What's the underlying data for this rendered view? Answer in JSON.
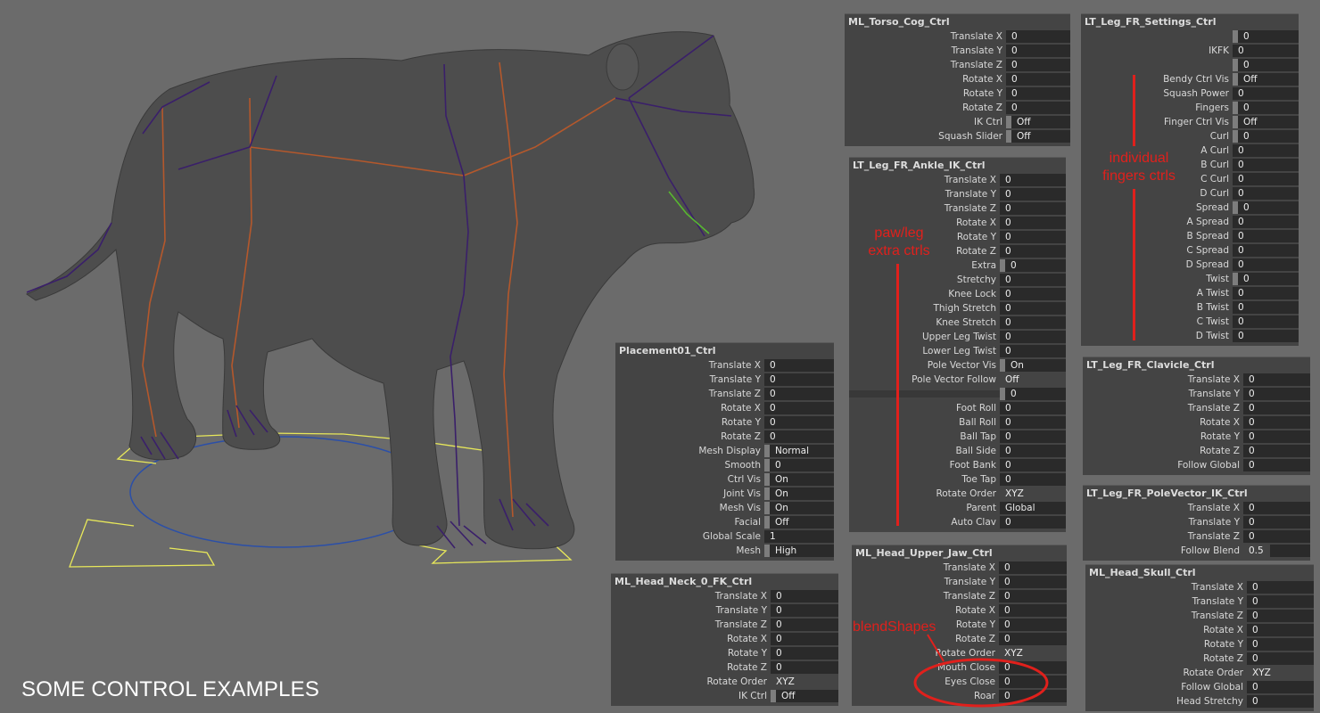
{
  "caption": "SOME CONTROL EXAMPLES",
  "annotations": {
    "paw_leg": "paw/leg\nextra ctrls",
    "fingers": "individual\nfingers ctrls",
    "blendshapes": "blendShapes"
  },
  "colors": {
    "viewport_bg": "#6b6b6b",
    "panel_bg": "#444444",
    "field_bg": "#2a2a2a",
    "annotation_red": "#e0201c",
    "spine_orange": "#b4582c",
    "joint_purple": "#3a1f6a",
    "placement_yellow": "#e8e85a",
    "placement_blue": "#2b4fa8"
  },
  "panels": {
    "torso_cog": {
      "title": "ML_Torso_Cog_Ctrl",
      "rows": [
        {
          "label": "Translate X",
          "value": "0"
        },
        {
          "label": "Translate Y",
          "value": "0"
        },
        {
          "label": "Translate Z",
          "value": "0"
        },
        {
          "label": "Rotate X",
          "value": "0"
        },
        {
          "label": "Rotate Y",
          "value": "0"
        },
        {
          "label": "Rotate Z",
          "value": "0"
        },
        {
          "label": "IK Ctrl",
          "value": "Off",
          "kind": "toggle"
        },
        {
          "label": "Squash Slider",
          "value": "Off",
          "kind": "toggle"
        }
      ]
    },
    "fr_settings": {
      "title": "LT_Leg_FR_Settings_Ctrl",
      "rows": [
        {
          "label": "",
          "value": "0",
          "kind": "toggle"
        },
        {
          "label": "IKFK",
          "value": "0"
        },
        {
          "label": "",
          "value": "0",
          "kind": "toggle"
        },
        {
          "label": "Bendy Ctrl Vis",
          "value": "Off",
          "kind": "toggle"
        },
        {
          "label": "Squash Power",
          "value": "0"
        },
        {
          "label": "Fingers",
          "value": "0",
          "kind": "toggle"
        },
        {
          "label": "Finger Ctrl Vis",
          "value": "Off",
          "kind": "toggle"
        },
        {
          "label": "Curl",
          "value": "0",
          "kind": "toggle"
        },
        {
          "label": "A Curl",
          "value": "0"
        },
        {
          "label": "B Curl",
          "value": "0"
        },
        {
          "label": "C Curl",
          "value": "0"
        },
        {
          "label": "D Curl",
          "value": "0"
        },
        {
          "label": "Spread",
          "value": "0",
          "kind": "toggle"
        },
        {
          "label": "A Spread",
          "value": "0"
        },
        {
          "label": "B Spread",
          "value": "0"
        },
        {
          "label": "C Spread",
          "value": "0"
        },
        {
          "label": "D Spread",
          "value": "0"
        },
        {
          "label": "Twist",
          "value": "0",
          "kind": "toggle"
        },
        {
          "label": "A Twist",
          "value": "0"
        },
        {
          "label": "B Twist",
          "value": "0"
        },
        {
          "label": "C Twist",
          "value": "0"
        },
        {
          "label": "D Twist",
          "value": "0"
        }
      ]
    },
    "fr_ankle_ik": {
      "title": "LT_Leg_FR_Ankle_IK_Ctrl",
      "rows": [
        {
          "label": "Translate X",
          "value": "0"
        },
        {
          "label": "Translate Y",
          "value": "0"
        },
        {
          "label": "Translate Z",
          "value": "0"
        },
        {
          "label": "Rotate X",
          "value": "0"
        },
        {
          "label": "Rotate Y",
          "value": "0"
        },
        {
          "label": "Rotate Z",
          "value": "0"
        },
        {
          "label": "Extra",
          "value": "0",
          "kind": "toggle"
        },
        {
          "label": "Stretchy",
          "value": "0"
        },
        {
          "label": "Knee Lock",
          "value": "0"
        },
        {
          "label": "Thigh Stretch",
          "value": "0"
        },
        {
          "label": "Knee Stretch",
          "value": "0"
        },
        {
          "label": "Upper Leg Twist",
          "value": "0"
        },
        {
          "label": "Lower Leg Twist",
          "value": "0"
        },
        {
          "label": "Pole Vector Vis",
          "value": "On",
          "kind": "toggle"
        },
        {
          "label": "Pole Vector Follow",
          "value": "Off",
          "kind": "enum"
        },
        {
          "label": "",
          "value": "0",
          "kind": "toggle",
          "sep": true
        },
        {
          "label": "Foot Roll",
          "value": "0"
        },
        {
          "label": "Ball Roll",
          "value": "0"
        },
        {
          "label": "Ball Tap",
          "value": "0"
        },
        {
          "label": "Ball Side",
          "value": "0"
        },
        {
          "label": "Foot Bank",
          "value": "0"
        },
        {
          "label": "Toe Tap",
          "value": "0"
        },
        {
          "label": "Rotate Order",
          "value": "XYZ",
          "kind": "enum"
        },
        {
          "label": "Parent",
          "value": "Global"
        },
        {
          "label": "Auto Clav",
          "value": "0"
        }
      ]
    },
    "placement": {
      "title": "Placement01_Ctrl",
      "rows": [
        {
          "label": "Translate X",
          "value": "0"
        },
        {
          "label": "Translate Y",
          "value": "0"
        },
        {
          "label": "Translate Z",
          "value": "0"
        },
        {
          "label": "Rotate X",
          "value": "0"
        },
        {
          "label": "Rotate Y",
          "value": "0"
        },
        {
          "label": "Rotate Z",
          "value": "0"
        },
        {
          "label": "Mesh Display",
          "value": "Normal",
          "kind": "toggle"
        },
        {
          "label": "Smooth",
          "value": "0",
          "kind": "toggle"
        },
        {
          "label": "Ctrl Vis",
          "value": "On",
          "kind": "toggle"
        },
        {
          "label": "Joint Vis",
          "value": "On",
          "kind": "toggle"
        },
        {
          "label": "Mesh Vis",
          "value": "On",
          "kind": "toggle"
        },
        {
          "label": "Facial",
          "value": "Off",
          "kind": "toggle"
        },
        {
          "label": "Global Scale",
          "value": "1"
        },
        {
          "label": "Mesh",
          "value": "High",
          "kind": "toggle"
        }
      ]
    },
    "neck_fk": {
      "title": "ML_Head_Neck_0_FK_Ctrl",
      "rows": [
        {
          "label": "Translate X",
          "value": "0"
        },
        {
          "label": "Translate Y",
          "value": "0"
        },
        {
          "label": "Translate Z",
          "value": "0"
        },
        {
          "label": "Rotate X",
          "value": "0"
        },
        {
          "label": "Rotate Y",
          "value": "0"
        },
        {
          "label": "Rotate Z",
          "value": "0"
        },
        {
          "label": "Rotate Order",
          "value": "XYZ",
          "kind": "enum"
        },
        {
          "label": "IK Ctrl",
          "value": "Off",
          "kind": "toggle"
        }
      ]
    },
    "upper_jaw": {
      "title": "ML_Head_Upper_Jaw_Ctrl",
      "rows": [
        {
          "label": "Translate X",
          "value": "0"
        },
        {
          "label": "Translate Y",
          "value": "0"
        },
        {
          "label": "Translate Z",
          "value": "0"
        },
        {
          "label": "Rotate X",
          "value": "0"
        },
        {
          "label": "Rotate Y",
          "value": "0"
        },
        {
          "label": "Rotate Z",
          "value": "0"
        },
        {
          "label": "Rotate Order",
          "value": "XYZ",
          "kind": "enum"
        },
        {
          "label": "Mouth Close",
          "value": "0"
        },
        {
          "label": "Eyes Close",
          "value": "0"
        },
        {
          "label": "Roar",
          "value": "0"
        }
      ]
    },
    "clavicle": {
      "title": "LT_Leg_FR_Clavicle_Ctrl",
      "rows": [
        {
          "label": "Translate X",
          "value": "0"
        },
        {
          "label": "Translate Y",
          "value": "0"
        },
        {
          "label": "Translate Z",
          "value": "0"
        },
        {
          "label": "Rotate X",
          "value": "0"
        },
        {
          "label": "Rotate Y",
          "value": "0"
        },
        {
          "label": "Rotate Z",
          "value": "0"
        },
        {
          "label": "Follow Global",
          "value": "0"
        }
      ]
    },
    "pole_vector": {
      "title": "LT_Leg_FR_PoleVector_IK_Ctrl",
      "rows": [
        {
          "label": "Translate X",
          "value": "0"
        },
        {
          "label": "Translate Y",
          "value": "0"
        },
        {
          "label": "Translate Z",
          "value": "0"
        },
        {
          "label": "Follow Blend",
          "value": "0.5",
          "kind": "half"
        }
      ]
    },
    "skull": {
      "title": "ML_Head_Skull_Ctrl",
      "rows": [
        {
          "label": "Translate X",
          "value": "0"
        },
        {
          "label": "Translate Y",
          "value": "0"
        },
        {
          "label": "Translate Z",
          "value": "0"
        },
        {
          "label": "Rotate X",
          "value": "0"
        },
        {
          "label": "Rotate Y",
          "value": "0"
        },
        {
          "label": "Rotate Z",
          "value": "0"
        },
        {
          "label": "Rotate Order",
          "value": "XYZ",
          "kind": "enum"
        },
        {
          "label": "Follow Global",
          "value": "0"
        },
        {
          "label": "Head Stretchy",
          "value": "0"
        }
      ]
    }
  }
}
